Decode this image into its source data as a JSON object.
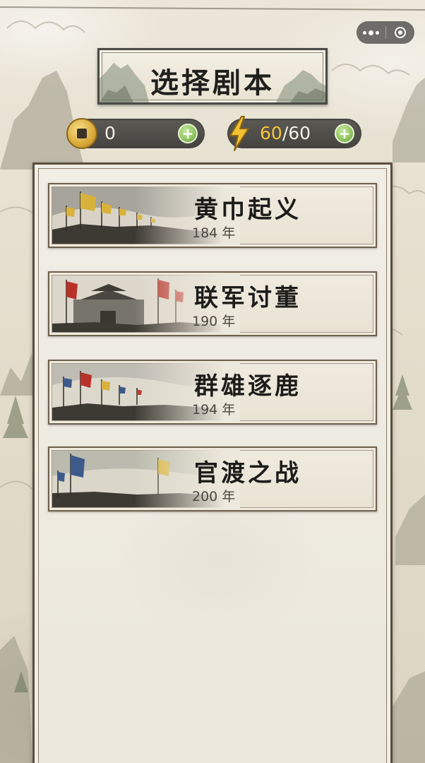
{
  "header": {
    "title": "选择剧本",
    "coins": "0",
    "energy_current": "60",
    "energy_separator": "/",
    "energy_max": "60",
    "add_coins_label": "+",
    "add_energy_label": "+"
  },
  "colors": {
    "accent_gold": "#f4c53a",
    "plus_green": "#8fc360",
    "ink": "#1c1c1a",
    "paper": "#f0ebdf",
    "frame": "#5a4e3e"
  },
  "icons": {
    "coin": "coin-icon",
    "energy": "lightning-bolt-icon",
    "add": "plus-icon",
    "menu": "more-dots-icon",
    "close": "target-circle-icon"
  },
  "scenarios": [
    {
      "name": "黄巾起义",
      "year": "184 年",
      "art": "yellow-banner-army"
    },
    {
      "name": "联军讨董",
      "year": "190 年",
      "art": "city-gate-red-banners"
    },
    {
      "name": "群雄逐鹿",
      "year": "194 年",
      "art": "cavalry-charge-banners"
    },
    {
      "name": "官渡之战",
      "year": "200 年",
      "art": "blue-yellow-banner-battle"
    }
  ]
}
